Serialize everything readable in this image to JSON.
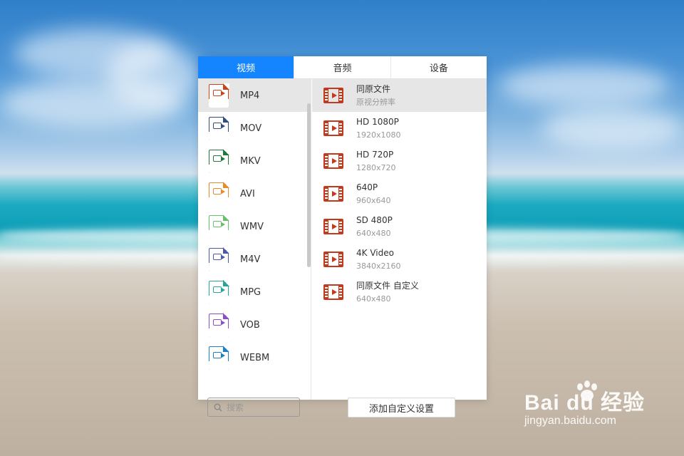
{
  "tabs": [
    {
      "label": "视频",
      "active": true
    },
    {
      "label": "音频",
      "active": false
    },
    {
      "label": "设备",
      "active": false
    }
  ],
  "formats": [
    {
      "label": "MP4",
      "tag": "MP4",
      "color": "#c8451c",
      "selected": true
    },
    {
      "label": "MOV",
      "tag": "MOV",
      "color": "#2f4e7e",
      "selected": false
    },
    {
      "label": "MKV",
      "tag": "MKV",
      "color": "#1f7a3a",
      "selected": false
    },
    {
      "label": "AVI",
      "tag": "AVI",
      "color": "#e88a2c",
      "selected": false
    },
    {
      "label": "WMV",
      "tag": "WMV",
      "color": "#6abf6a",
      "selected": false
    },
    {
      "label": "M4V",
      "tag": "M4V",
      "color": "#4a5aa8",
      "selected": false
    },
    {
      "label": "MPG",
      "tag": "MPG",
      "color": "#26a59a",
      "selected": false
    },
    {
      "label": "VOB",
      "tag": "VOB",
      "color": "#8a4fc8",
      "selected": false
    },
    {
      "label": "WEBM",
      "tag": "WEBM",
      "color": "#1d7fc4",
      "selected": false
    }
  ],
  "search": {
    "placeholder": "搜索",
    "icon": "search-icon"
  },
  "presets": [
    {
      "name": "同原文件",
      "resolution": "原视分辨率",
      "selected": true
    },
    {
      "name": "HD 1080P",
      "resolution": "1920x1080",
      "selected": false
    },
    {
      "name": "HD 720P",
      "resolution": "1280x720",
      "selected": false
    },
    {
      "name": "640P",
      "resolution": "960x640",
      "selected": false
    },
    {
      "name": "SD 480P",
      "resolution": "640x480",
      "selected": false
    },
    {
      "name": "4K Video",
      "resolution": "3840x2160",
      "selected": false
    },
    {
      "name": "同原文件 自定义",
      "resolution": "640x480",
      "selected": false
    }
  ],
  "add_custom_label": "添加自定义设置",
  "watermark": {
    "main": "Bai du 经验",
    "sub": "jingyan.baidu.com"
  },
  "colors": {
    "accent": "#1585ff",
    "preset_icon": "#c4391b"
  }
}
